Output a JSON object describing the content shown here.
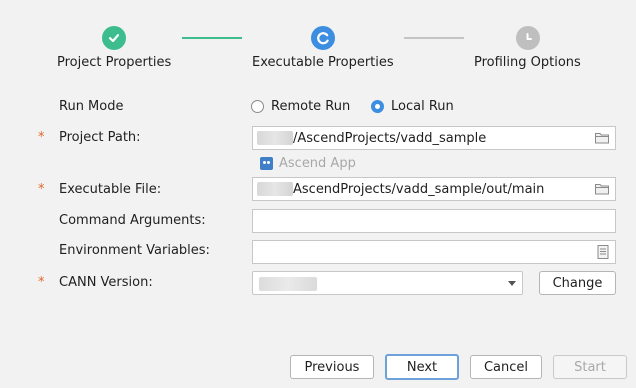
{
  "stepper": {
    "steps": [
      {
        "label": "Project Properties",
        "state": "completed"
      },
      {
        "label": "Executable Properties",
        "state": "active"
      },
      {
        "label": "Profiling Options",
        "state": "pending"
      }
    ],
    "colors": {
      "completed": "#3dbd8e",
      "active": "#3d8ee0",
      "pending": "#bfbfbf"
    }
  },
  "form": {
    "run_mode": {
      "label": "Run Mode",
      "options": [
        {
          "label": "Remote Run",
          "checked": false
        },
        {
          "label": "Local Run",
          "checked": true
        }
      ]
    },
    "project_path": {
      "label": "Project Path:",
      "required": "*",
      "value": "/AscendProjects/vadd_sample",
      "icon": "folder-icon"
    },
    "ascend_app": {
      "label": "Ascend App",
      "icon": "ascend-app-icon"
    },
    "executable_file": {
      "label": "Executable File:",
      "required": "*",
      "value": "AscendProjects/vadd_sample/out/main",
      "icon": "folder-icon"
    },
    "command_arguments": {
      "label": "Command Arguments:",
      "value": ""
    },
    "environment_variables": {
      "label": "Environment Variables:",
      "value": "",
      "icon": "document-icon"
    },
    "cann_version": {
      "label": "CANN Version:",
      "required": "*",
      "value": "",
      "change_label": "Change"
    }
  },
  "footer": {
    "previous_label": "Previous",
    "next_label": "Next",
    "cancel_label": "Cancel",
    "start_label": "Start"
  },
  "colors": {
    "accent": "#3d8ee0",
    "required": "#e0672d"
  }
}
